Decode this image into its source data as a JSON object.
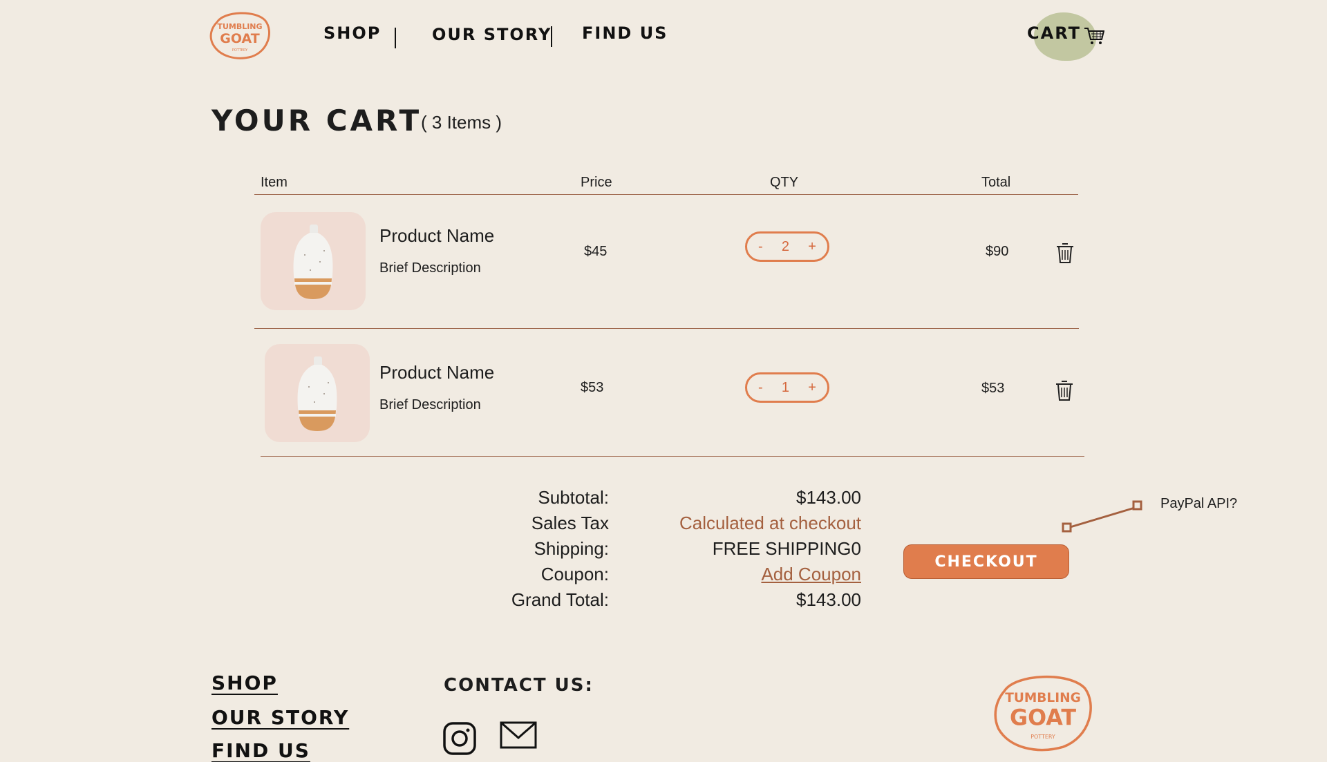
{
  "header": {
    "logo_line1": "TUMBLING",
    "logo_line2": "GOAT",
    "logo_line3": "POTTERY",
    "nav": [
      "SHOP",
      "OUR STORY",
      "FIND US"
    ],
    "cart_label": "CART"
  },
  "page": {
    "title": "YOUR CART",
    "item_count": "( 3 Items )"
  },
  "table": {
    "headers": {
      "item": "Item",
      "price": "Price",
      "qty": "QTY",
      "total": "Total"
    },
    "rows": [
      {
        "name": "Product Name",
        "description": "Brief Description",
        "price": "$45",
        "qty": "2",
        "total": "$90"
      },
      {
        "name": "Product Name",
        "description": "Brief Description",
        "price": "$53",
        "qty": "1",
        "total": "$53"
      }
    ],
    "minus": "-",
    "plus": "+"
  },
  "summary": {
    "subtotal_label": "Subtotal:",
    "subtotal_value": "$143.00",
    "tax_label": "Sales Tax",
    "tax_value": "Calculated at checkout",
    "shipping_label": "Shipping:",
    "shipping_value": "FREE SHIPPING0",
    "coupon_label": "Coupon:",
    "coupon_value": "Add Coupon",
    "grand_label": "Grand Total:",
    "grand_value": "$143.00",
    "checkout_label": "CHECKOUT",
    "annotation": "PayPal API?"
  },
  "footer": {
    "links": [
      "SHOP",
      "OUR STORY",
      "FIND US"
    ],
    "contact_title": "CONTACT US:",
    "icons": [
      "instagram-icon",
      "mail-icon"
    ]
  },
  "colors": {
    "background": "#f1ebe2",
    "accent": "#e07d4d",
    "cart_highlight": "#c2c7a1",
    "thumb_bg": "#f0dcd3",
    "tax_text": "#a4603f"
  }
}
